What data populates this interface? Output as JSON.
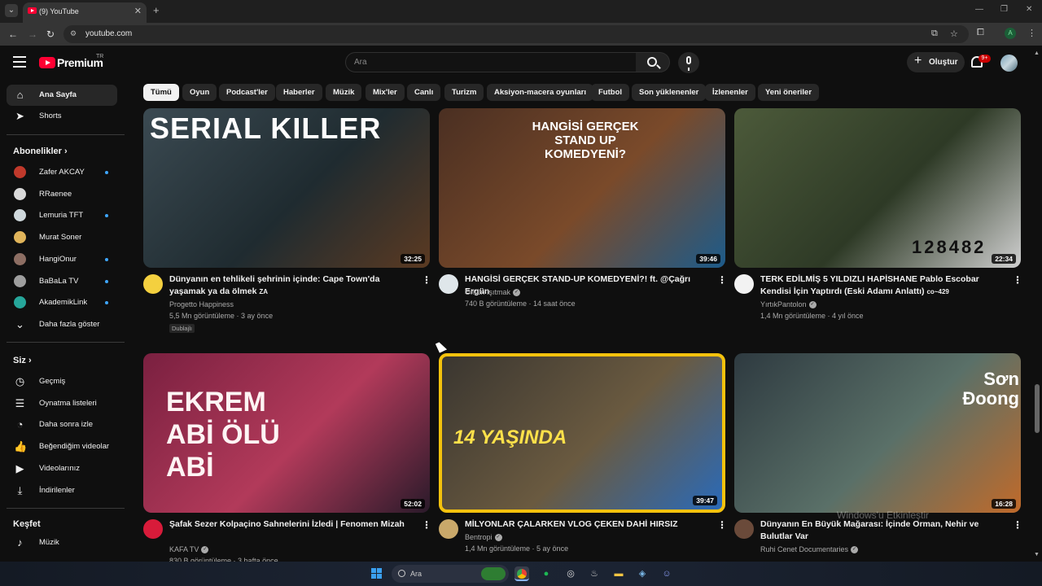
{
  "browser": {
    "tab_title": "(9) YouTube",
    "url": "youtube.com",
    "profile_initial": "A",
    "tab_menu_icon": "chevron-down-icon",
    "new_tab_symbol": "+",
    "close_symbol": "✕"
  },
  "header": {
    "logo_text": "Premium",
    "logo_superscript": "TR",
    "search_placeholder": "Ara",
    "create_label": "Oluştur",
    "notification_count": "9+"
  },
  "sidebar": {
    "main": [
      {
        "label": "Ana Sayfa",
        "icon": "home-icon",
        "active": true
      },
      {
        "label": "Shorts",
        "icon": "shorts-icon"
      }
    ],
    "subscriptions_heading": "Abonelikler",
    "subscriptions": [
      {
        "label": "Zafer AKCAY",
        "color": "#c0392b",
        "live": true
      },
      {
        "label": "RRaenee",
        "color": "#d9d9d9",
        "live": false
      },
      {
        "label": "Lemuria TFT",
        "color": "#cfd8dc",
        "live": true
      },
      {
        "label": "Murat Soner",
        "color": "#e0b45a",
        "live": false
      },
      {
        "label": "HangiOnur",
        "color": "#8d6e63",
        "live": true
      },
      {
        "label": "BaBaLa TV",
        "color": "#9e9e9e",
        "live": true
      },
      {
        "label": "AkademikLink",
        "color": "#26a69a",
        "live": true
      }
    ],
    "show_more": "Daha fazla göster",
    "you_heading": "Siz",
    "you_items": [
      {
        "label": "Geçmiş",
        "icon": "history-icon"
      },
      {
        "label": "Oynatma listeleri",
        "icon": "playlists-icon"
      },
      {
        "label": "Daha sonra izle",
        "icon": "watch-later-icon"
      },
      {
        "label": "Beğendiğim videolar",
        "icon": "liked-icon"
      },
      {
        "label": "Videolarınız",
        "icon": "your-videos-icon"
      },
      {
        "label": "İndirilenler",
        "icon": "downloads-icon"
      }
    ],
    "explore_heading": "Keşfet",
    "explore_items": [
      {
        "label": "Müzik",
        "icon": "music-icon"
      }
    ]
  },
  "chips": [
    "Tümü",
    "Oyun",
    "Podcast'ler",
    "Haberler",
    "Müzik",
    "Mix'ler",
    "Canlı",
    "Turizm",
    "Aksiyon-macera oyunları",
    "Futbol",
    "Son yüklenenler",
    "İzlenenler",
    "Yeni öneriler"
  ],
  "videos": [
    {
      "title": "Dünyanın en tehlikeli şehrinin içinde: Cape Town'da yaşamak ya da ölmek",
      "title_suffix": "ZA",
      "channel": "Progetto Happiness",
      "verified": false,
      "meta": "5,5 Mn görüntüleme · 3 ay önce",
      "badge": "Dublajlı",
      "duration": "32:25",
      "thumb_text": "SERIAL KILLER",
      "colors": [
        "#3b4a52",
        "#1f2b30",
        "#5b3a22"
      ]
    },
    {
      "title": "HANGİSİ GERÇEK STAND-UP KOMEDYENİ?! ft. @Çağrı Ergün",
      "title_suffix": "",
      "channel": "Orkun Işıtmak",
      "verified": true,
      "meta": "740 B görüntüleme · 14 saat önce",
      "badge": "",
      "duration": "39:46",
      "thumb_text": "HANGİSİ GERÇEK STAND UP KOMEDYENİ?",
      "colors": [
        "#4a2f22",
        "#7a4a2a",
        "#1d5b8a"
      ]
    },
    {
      "title": "TERK EDİLMİŞ 5 YILDIZLI HAPİSHANE Pablo Escobar Kendisi İçin Yaptırdı (Eski Adamı Anlattı)",
      "title_suffix": "co~429",
      "channel": "YırtıkPantolon",
      "verified": true,
      "meta": "1,4 Mn görüntüleme · 4 yıl önce",
      "badge": "",
      "duration": "22:34",
      "thumb_text": "128482",
      "colors": [
        "#4c5a3a",
        "#2e3a26",
        "#cfcfcf"
      ]
    },
    {
      "title": "Şafak Sezer Kolpaçino Sahnelerini İzledi | Fenomen Mizah",
      "title_suffix": "",
      "channel": "KAFA TV",
      "verified": true,
      "meta": "830 B görüntüleme · 3 hafta önce",
      "badge": "",
      "duration": "52:02",
      "thumb_text": "EKREM ABİ ÖLÜ ABİ",
      "colors": [
        "#7a2040",
        "#b23a5a",
        "#2a1a2a"
      ]
    },
    {
      "title": "MİLYONLAR ÇALARKEN VLOG ÇEKEN DAHİ HIRSIZ",
      "title_suffix": "",
      "channel": "Bentropi",
      "verified": true,
      "meta": "1,4 Mn görüntüleme · 5 ay önce",
      "badge": "",
      "duration": "39:47",
      "thumb_text": "14 YAŞINDA",
      "colors": [
        "#3a3630",
        "#6a5a40",
        "#2a6ab8"
      ]
    },
    {
      "title": "Dünyanın En Büyük Mağarası: İçinde Orman, Nehir ve Bulutlar Var",
      "title_suffix": "",
      "channel": "Ruhi Cenet Documentaries",
      "verified": true,
      "meta": "",
      "badge": "",
      "duration": "16:28",
      "thumb_text": "Sơn Đoong",
      "colors": [
        "#2e3a40",
        "#5a7068",
        "#c06a2a"
      ]
    }
  ],
  "overlay": {
    "watermark": "Windows'u Etkinleştir"
  },
  "taskbar": {
    "search_label": "Ara"
  }
}
